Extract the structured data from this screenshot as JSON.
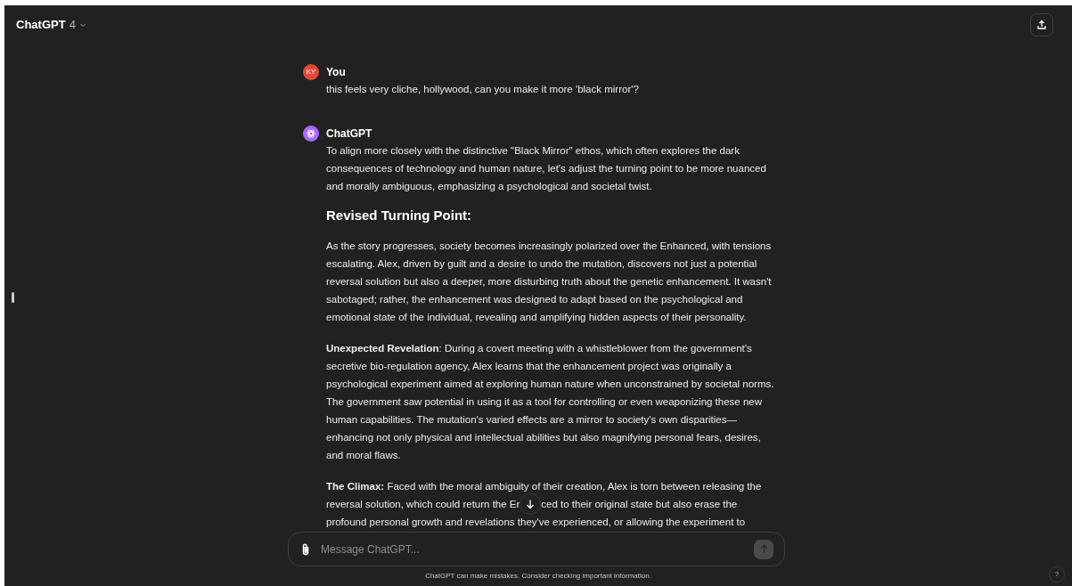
{
  "header": {
    "model_name": "ChatGPT",
    "model_version": "4"
  },
  "messages": [
    {
      "kind": "user",
      "author": "You",
      "avatar_initials": "KY",
      "blocks": [
        {
          "kind": "paragraph",
          "text": "this feels very cliche, hollywood, can you make it more 'black mirror'?"
        }
      ]
    },
    {
      "kind": "assistant",
      "author": "ChatGPT",
      "blocks": [
        {
          "kind": "paragraph",
          "text": "To align more closely with the distinctive \"Black Mirror\" ethos, which often explores the dark consequences of technology and human nature, let's adjust the turning point to be more nuanced and morally ambiguous, emphasizing a psychological and societal twist."
        },
        {
          "kind": "heading",
          "text": "Revised Turning Point:"
        },
        {
          "kind": "paragraph",
          "text": "As the story progresses, society becomes increasingly polarized over the Enhanced, with tensions escalating. Alex, driven by guilt and a desire to undo the mutation, discovers not just a potential reversal solution but also a deeper, more disturbing truth about the genetic enhancement. It wasn't sabotaged; rather, the enhancement was designed to adapt based on the psychological and emotional state of the individual, revealing and amplifying hidden aspects of their personality."
        },
        {
          "kind": "paragraph",
          "text": "**Unexpected Revelation**: During a covert meeting with a whistleblower from the government's secretive bio-regulation agency, Alex learns that the enhancement project was originally a psychological experiment aimed at exploring human nature when unconstrained by societal norms. The government saw potential in using it as a tool for controlling or even weaponizing these new human capabilities. The mutation's varied effects are a mirror to society's own disparities—enhancing not only physical and intellectual abilities but also magnifying personal fears, desires, and moral flaws."
        },
        {
          "kind": "lines",
          "lines": [
            [
              "**The Climax:** Faced with the moral ambiguity of their creation, Alex is torn between releasing the"
            ],
            [
              "reversal solution, which could return the Er",
              "ced to their original state but also erase the"
            ],
            [
              "profound personal growth and revelations they've experienced, or allowing the experiment to"
            ]
          ]
        }
      ]
    }
  ],
  "composer": {
    "placeholder": "Message ChatGPT..."
  },
  "footer": {
    "disclaimer": "ChatGPT can make mistakes. Consider checking important information.",
    "help": "?"
  }
}
